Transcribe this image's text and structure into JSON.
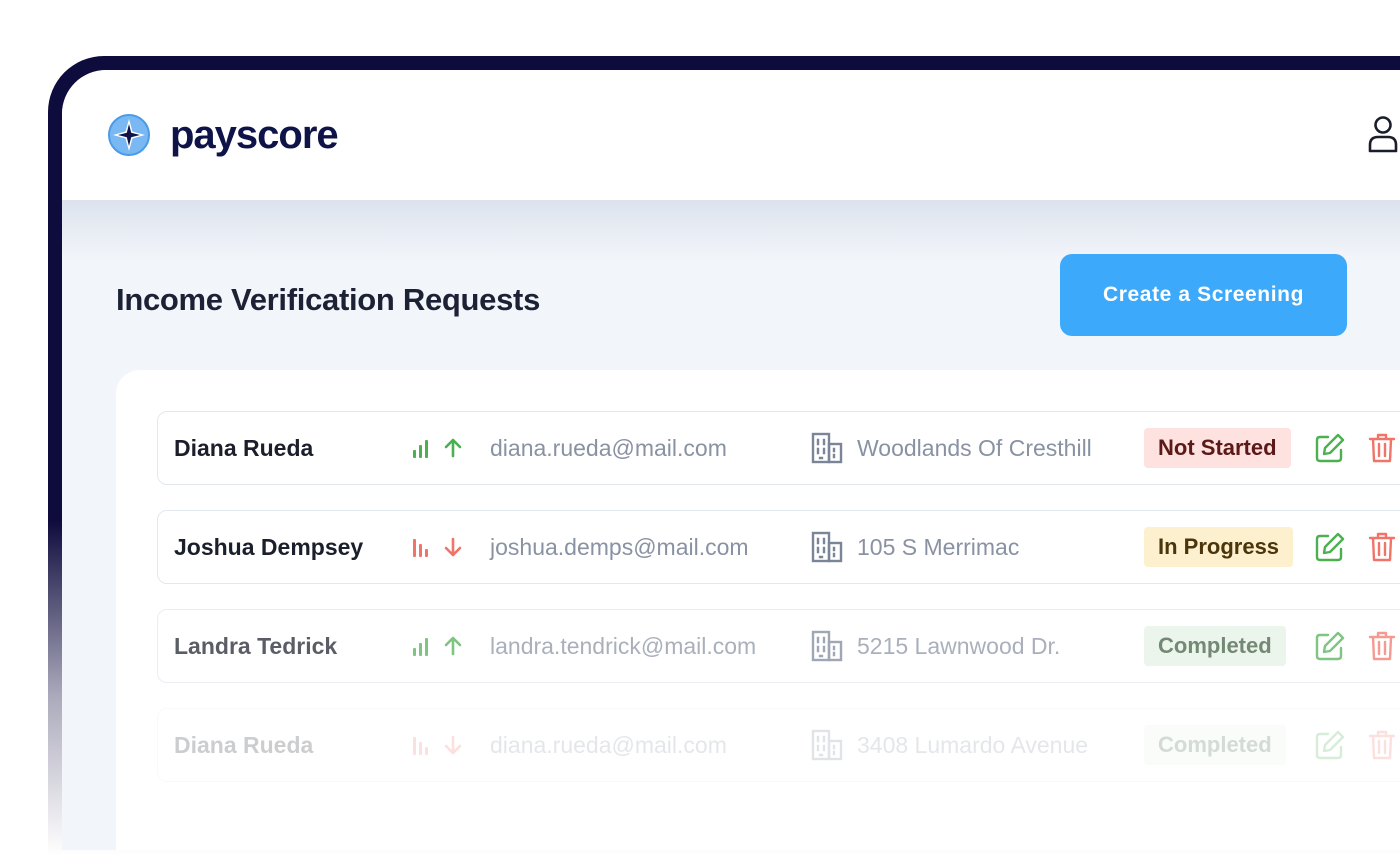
{
  "app": {
    "brand": "payscore"
  },
  "page": {
    "title": "Income Verification Requests",
    "cta_label": "Create a Screening"
  },
  "icons": {
    "logo": "payscore-star-logo",
    "user": "user-icon",
    "trend_up": "signal-up-icon",
    "trend_down": "signal-down-icon",
    "building": "building-icon",
    "edit": "edit-icon",
    "delete": "trash-icon"
  },
  "colors": {
    "accent": "#3da9fb",
    "navy": "#0e1447",
    "up": "#4caf50",
    "down": "#f07468",
    "not_started_bg": "#fde2e0",
    "not_started_fg": "#5b1a17",
    "in_progress_bg": "#fdf0cf",
    "in_progress_fg": "#4a360a",
    "completed_bg": "#e5f2e6",
    "completed_fg": "#3e5c41"
  },
  "requests": [
    {
      "name": "Diana Rueda",
      "email": "diana.rueda@mail.com",
      "address": "Woodlands Of Cresthill",
      "status": "Not Started",
      "trend": "up"
    },
    {
      "name": "Joshua Dempsey",
      "email": "joshua.demps@mail.com",
      "address": "105 S Merrimac",
      "status": "In Progress",
      "trend": "down"
    },
    {
      "name": "Landra Tedrick",
      "email": "landra.tendrick@mail.com",
      "address": "5215 Lawnwood Dr.",
      "status": "Completed",
      "trend": "up"
    },
    {
      "name": "Diana Rueda",
      "email": "diana.rueda@mail.com",
      "address": "3408 Lumardo Avenue",
      "status": "Completed",
      "trend": "down"
    }
  ]
}
